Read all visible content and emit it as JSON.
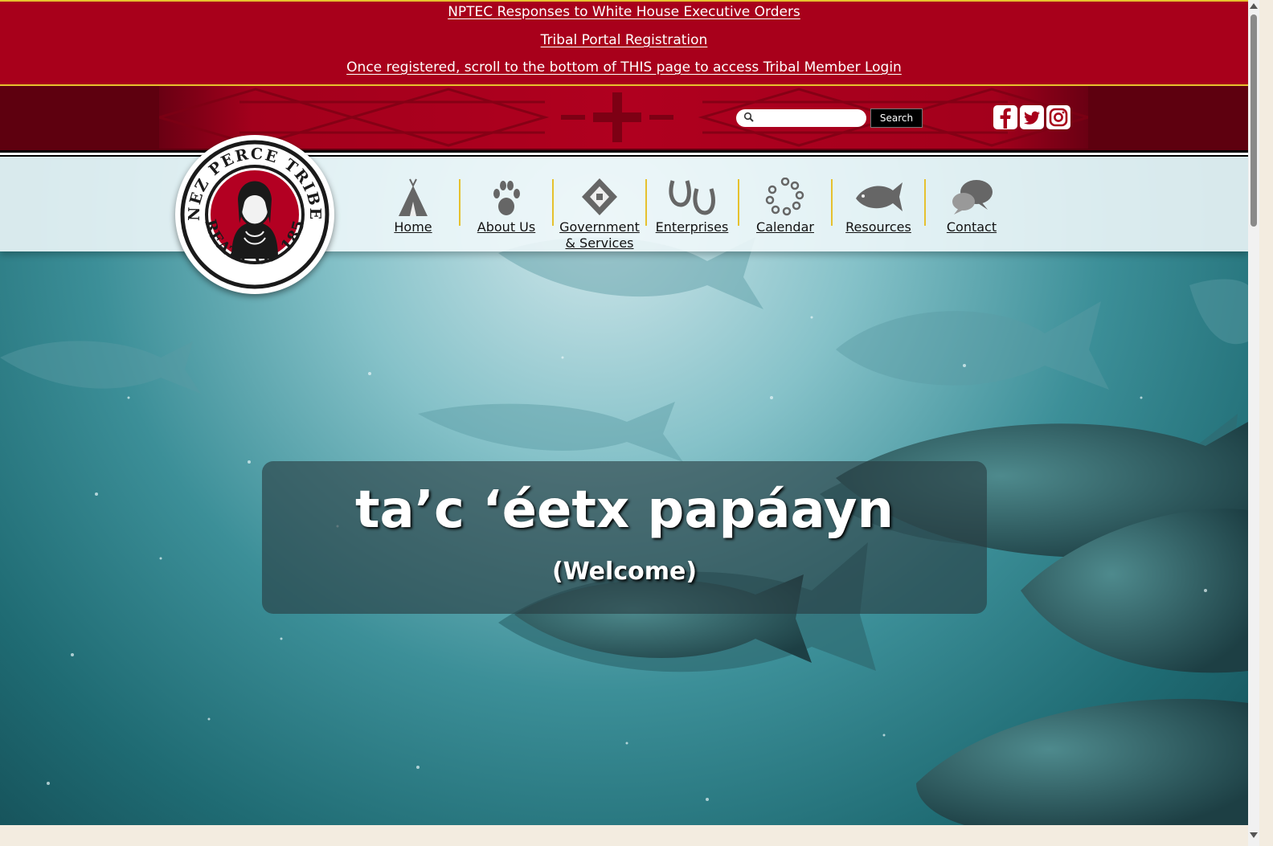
{
  "announcements": {
    "link1": "NPTEC Responses to White House Executive Orders",
    "link2": "Tribal Portal Registration",
    "notice": "Once registered, scroll to the bottom of THIS page to access Tribal Member Login"
  },
  "search": {
    "placeholder": "",
    "button_label": "Search"
  },
  "social": [
    "facebook-icon",
    "twitter-icon",
    "instagram-icon"
  ],
  "logo": {
    "top_text": "NEZ PERCE TRIBE",
    "bottom_text": "TREATY OF 1855"
  },
  "nav": {
    "items": [
      {
        "label": "Home",
        "icon": "tipi-icon"
      },
      {
        "label": "About Us",
        "icon": "paw-print-icon"
      },
      {
        "label": "Government",
        "label2": "& Services",
        "icon": "emblem-icon"
      },
      {
        "label": "Enterprises",
        "icon": "horseshoe-icon"
      },
      {
        "label": "Calendar",
        "icon": "dot-circle-icon"
      },
      {
        "label": "Resources",
        "icon": "salmon-icon"
      },
      {
        "label": "Contact",
        "icon": "speech-bubbles-icon"
      }
    ]
  },
  "hero": {
    "title": "ta’c ‘éetx papáayn",
    "subtitle": "(Welcome)"
  },
  "colors": {
    "brand_red": "#a8001b",
    "banner_dark": "#5e000f",
    "gold_accent": "#e6c12e"
  }
}
